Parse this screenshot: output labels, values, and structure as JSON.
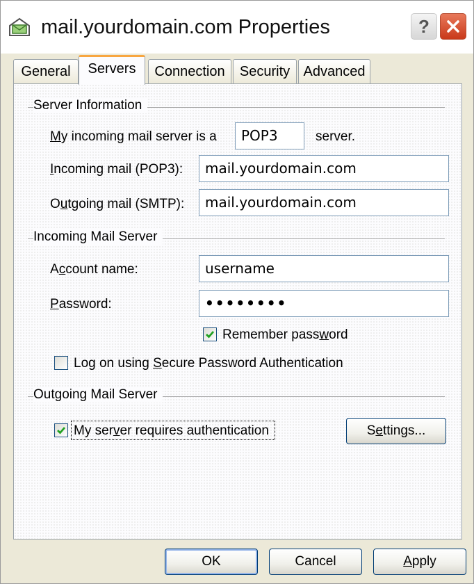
{
  "window": {
    "title": "mail.yourdomain.com Properties",
    "help_label": "?",
    "icons": {
      "title": "mail-account-icon",
      "help": "help-icon",
      "close": "close-icon"
    }
  },
  "tabs": [
    {
      "label": "General",
      "active": false
    },
    {
      "label": "Servers",
      "active": true
    },
    {
      "label": "Connection",
      "active": false
    },
    {
      "label": "Security",
      "active": false
    },
    {
      "label": "Advanced",
      "active": false
    }
  ],
  "server_information": {
    "heading": "Server Information",
    "incoming_type_label_pre": "y incoming mail server is a",
    "incoming_type_label_u": "M",
    "incoming_type_value": "POP3",
    "incoming_type_suffix": "server.",
    "incoming_label_u": "I",
    "incoming_label_rest": "ncoming mail (POP3):",
    "incoming_value": "mail.yourdomain.com",
    "outgoing_label_pre": "O",
    "outgoing_label_u": "u",
    "outgoing_label_rest": "tgoing mail (SMTP):",
    "outgoing_value": "mail.yourdomain.com"
  },
  "incoming_mail_server": {
    "heading": "Incoming Mail Server",
    "account_label_pre": "A",
    "account_label_u": "c",
    "account_label_rest": "count name:",
    "account_value": "username",
    "password_label_u": "P",
    "password_label_rest": "assword:",
    "password_value": "••••••••",
    "remember_label_pre": "Remember pass",
    "remember_label_u": "w",
    "remember_label_rest": "ord",
    "remember_checked": true,
    "spa_label_pre": "Log on using ",
    "spa_label_u": "S",
    "spa_label_rest": "ecure Password Authentication",
    "spa_checked": false
  },
  "outgoing_mail_server": {
    "heading": "Outgoing Mail Server",
    "auth_label_pre": "My ser",
    "auth_label_u": "v",
    "auth_label_rest": "er requires authentication",
    "auth_checked": true,
    "settings_pre": "S",
    "settings_u": "e",
    "settings_rest": "ttings..."
  },
  "buttons": {
    "ok": "OK",
    "cancel": "Cancel",
    "apply_u": "A",
    "apply_rest": "pply"
  },
  "colors": {
    "dialog_bg": "#ece9d8",
    "accent_tab": "#f8a640",
    "check_green": "#21a121",
    "close_red": "#c9391a"
  }
}
